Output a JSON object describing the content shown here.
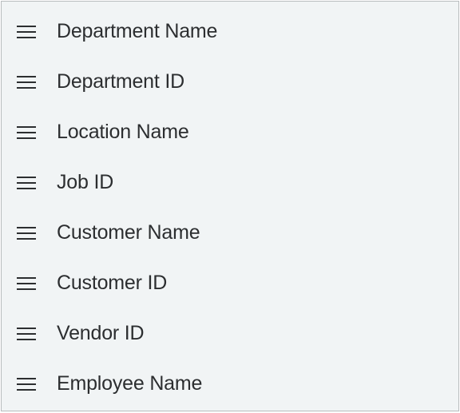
{
  "items": [
    {
      "label": "Department Name"
    },
    {
      "label": "Department ID"
    },
    {
      "label": "Location Name"
    },
    {
      "label": "Job ID"
    },
    {
      "label": "Customer Name"
    },
    {
      "label": "Customer ID"
    },
    {
      "label": "Vendor ID"
    },
    {
      "label": "Employee Name"
    }
  ]
}
